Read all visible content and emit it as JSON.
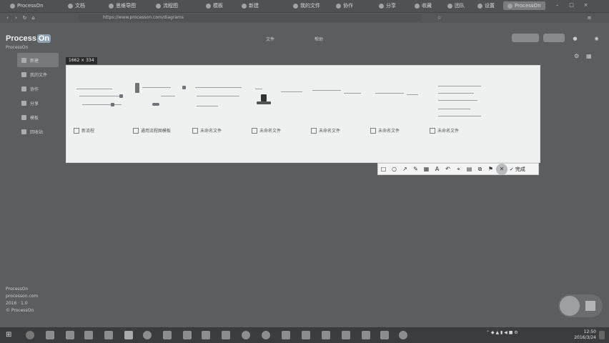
{
  "browser": {
    "tabs": [
      {
        "label": "ProcessOn"
      },
      {
        "label": "文档"
      },
      {
        "label": "思维导图"
      },
      {
        "label": "流程图"
      },
      {
        "label": "模板"
      },
      {
        "label": "新建"
      },
      {
        "label": "我的文件"
      },
      {
        "label": "协作"
      },
      {
        "label": "分享"
      },
      {
        "label": "收藏"
      },
      {
        "label": "团队"
      },
      {
        "label": "设置"
      },
      {
        "label": "ProcessOn"
      }
    ],
    "address": "https://www.processon.com/diagrams"
  },
  "app": {
    "logo_text": "Process",
    "logo_badge": "On",
    "subtitle": "ProcessOn",
    "header_links": [
      "文件",
      "帮助"
    ]
  },
  "sidebar": {
    "items": [
      {
        "label": "新建"
      },
      {
        "label": "我的文件"
      },
      {
        "label": "协作"
      },
      {
        "label": "分享"
      },
      {
        "label": "模板"
      },
      {
        "label": "回收站"
      }
    ]
  },
  "screenshot": {
    "size_badge": "1662 × 334",
    "files": [
      {
        "label": "新流程"
      },
      {
        "label": "通用流程图模板"
      },
      {
        "label": "未命名文件"
      },
      {
        "label": "未命名文件"
      },
      {
        "label": "未命名文件"
      },
      {
        "label": "未命名文件"
      },
      {
        "label": "未命名文件"
      }
    ]
  },
  "toolbar": {
    "done_label": "完成",
    "tools": [
      "rect-icon",
      "ellipse-icon",
      "arrow-icon",
      "pen-icon",
      "mosaic-icon",
      "text-icon",
      "undo-icon",
      "pin-icon",
      "save-icon",
      "copy-icon",
      "flag-icon",
      "close-icon"
    ]
  },
  "footer": {
    "lines": [
      "ProcessOn",
      "processon.com",
      "2016 · 1.0",
      "© ProcessOn"
    ]
  },
  "taskbar": {
    "time": "12:50",
    "date": "2016/3/24"
  },
  "colors": {
    "background": "#5b5d5e",
    "screenshot_bg": "#eff0f0",
    "toolbar_bg": "#f4f4f4"
  }
}
